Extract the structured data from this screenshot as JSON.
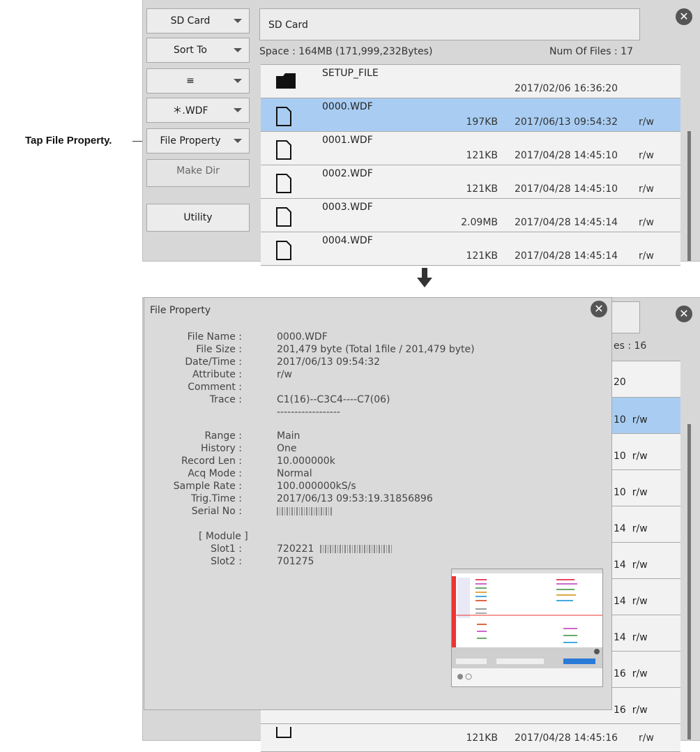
{
  "callout": "Tap File Property.",
  "buttons": {
    "drive": "SD Card",
    "sort": "Sort To",
    "view": "≡",
    "filter": "＊.WDF",
    "file_property": "File Property",
    "make_dir": "Make Dir",
    "utility": "Utility"
  },
  "path": "SD Card",
  "space": "Space : 164MB (171,999,232Bytes)",
  "num_files": "Num Of Files : 17",
  "files": [
    {
      "name": "SETUP_FILE",
      "size": "",
      "date": "2017/02/06 16:36:20",
      "attr": "",
      "type": "folder",
      "selected": false
    },
    {
      "name": "0000.WDF",
      "size": "197KB",
      "date": "2017/06/13 09:54:32",
      "attr": "r/w",
      "type": "file",
      "selected": true
    },
    {
      "name": "0001.WDF",
      "size": "121KB",
      "date": "2017/04/28 14:45:10",
      "attr": "r/w",
      "type": "file",
      "selected": false
    },
    {
      "name": "0002.WDF",
      "size": "121KB",
      "date": "2017/04/28 14:45:10",
      "attr": "r/w",
      "type": "file",
      "selected": false
    },
    {
      "name": "0003.WDF",
      "size": "2.09MB",
      "date": "2017/04/28 14:45:14",
      "attr": "r/w",
      "type": "file",
      "selected": false
    },
    {
      "name": "0004.WDF",
      "size": "121KB",
      "date": "2017/04/28 14:45:14",
      "attr": "r/w",
      "type": "file",
      "selected": false
    }
  ],
  "bg": {
    "files_count": "es : 16",
    "rows": [
      "20",
      "10  r/w",
      "10  r/w",
      "10  r/w",
      "14  r/w",
      "14  r/w",
      "14  r/w",
      "14  r/w",
      "16  r/w",
      "16  r/w"
    ],
    "last_size": "121KB",
    "last_date": "2017/04/28 14:45:16",
    "last_attr": "r/w"
  },
  "dialog": {
    "title": "File Property",
    "props": [
      {
        "label": "File Name :",
        "value": "0000.WDF"
      },
      {
        "label": "File Size :",
        "value": "201,479 byte (Total 1file / 201,479 byte)"
      },
      {
        "label": "Date/Time :",
        "value": "2017/06/13 09:54:32"
      },
      {
        "label": "Attribute :",
        "value": "r/w"
      },
      {
        "label": "Comment :",
        "value": ""
      },
      {
        "label": "Trace :",
        "value": "C1(16)--C3C4----C7(06)"
      }
    ],
    "separator": "------------------",
    "props2": [
      {
        "label": "Range :",
        "value": "Main"
      },
      {
        "label": "History :",
        "value": "One"
      },
      {
        "label": "Record Len :",
        "value": "10.000000k"
      },
      {
        "label": "Acq Mode :",
        "value": "Normal"
      },
      {
        "label": "Sample Rate :",
        "value": "100.000000kS/s"
      },
      {
        "label": "Trig.Time :",
        "value": "2017/06/13 09:53:19.31856896"
      },
      {
        "label": "Serial No :",
        "value": ""
      }
    ],
    "module_header": "[ Module ]",
    "slots": [
      {
        "label": "Slot1 :",
        "value": "720221"
      },
      {
        "label": "Slot2 :",
        "value": "701275"
      }
    ]
  },
  "colors": {
    "selected_row": "#a9cdf2",
    "panel": "#d7d7d7"
  }
}
